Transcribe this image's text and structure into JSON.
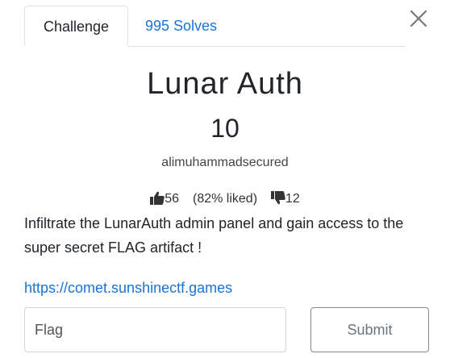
{
  "tabs": {
    "challenge_label": "Challenge",
    "solves_label": "995 Solves"
  },
  "challenge": {
    "name": "Lunar Auth",
    "points": "10",
    "author": "alimuhammadsecured"
  },
  "rating": {
    "likes": "56",
    "liked_percent": "(82% liked)",
    "dislikes": "12"
  },
  "description": "Infiltrate the LunarAuth admin panel and gain access to the super secret FLAG artifact !",
  "link": "https://comet.sunshinectf.games",
  "form": {
    "flag_placeholder": "Flag",
    "submit_label": "Submit"
  },
  "colors": {
    "link": "#1a73d9",
    "border": "#dee2e6"
  }
}
